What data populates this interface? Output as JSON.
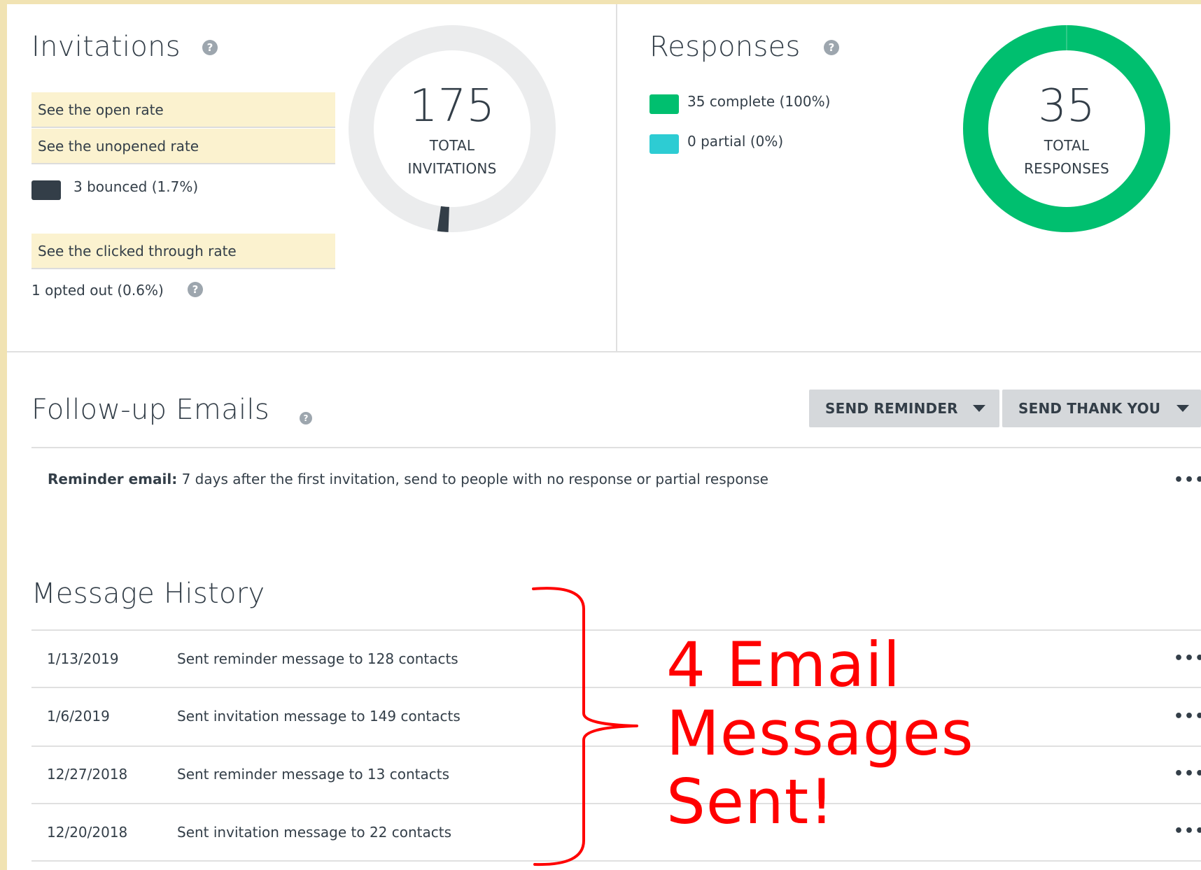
{
  "invitations": {
    "title": "Invitations",
    "help_glyph": "?",
    "rate_links": [
      "See the open rate",
      "See the unopened rate",
      "See the clicked through rate"
    ],
    "bounced": {
      "count": "3",
      "text": "bounced (1.7%)",
      "color": "#333e48"
    },
    "opted_out": {
      "count": "1",
      "text": "opted out (0.6%)"
    },
    "donut": {
      "total": "175",
      "label_line1": "TOTAL",
      "label_line2": "INVITATIONS",
      "ring_color": "#ebeced",
      "bounced_fraction": 0.017
    }
  },
  "responses": {
    "title": "Responses",
    "complete": {
      "count": "35",
      "text": "complete (100%)",
      "color": "#00bf6f"
    },
    "partial": {
      "count": "0",
      "text": "partial (0%)",
      "color": "#2dccd3"
    },
    "donut": {
      "total": "35",
      "label_line1": "TOTAL",
      "label_line2": "RESPONSES",
      "complete_fraction": 1.0
    }
  },
  "followup": {
    "title": "Follow-up Emails",
    "send_reminder_label": "SEND REMINDER",
    "send_thank_you_label": "SEND THANK YOU",
    "reminder_bold": "Reminder email:",
    "reminder_text": " 7 days after the first invitation, send to people with no response or partial response",
    "more_glyph": "•••"
  },
  "history": {
    "title": "Message History",
    "rows": [
      {
        "date": "1/13/2019",
        "message": "Sent reminder message to 128 contacts"
      },
      {
        "date": "1/6/2019",
        "message": "Sent invitation message to 149 contacts"
      },
      {
        "date": "12/27/2018",
        "message": "Sent reminder message to 13 contacts"
      },
      {
        "date": "12/20/2018",
        "message": "Sent invitation message to 22 contacts"
      }
    ],
    "more_glyph": "•••"
  },
  "annotation": {
    "lines": [
      "4 Email",
      "Messages",
      "Sent!"
    ],
    "color": "#ff0000"
  }
}
